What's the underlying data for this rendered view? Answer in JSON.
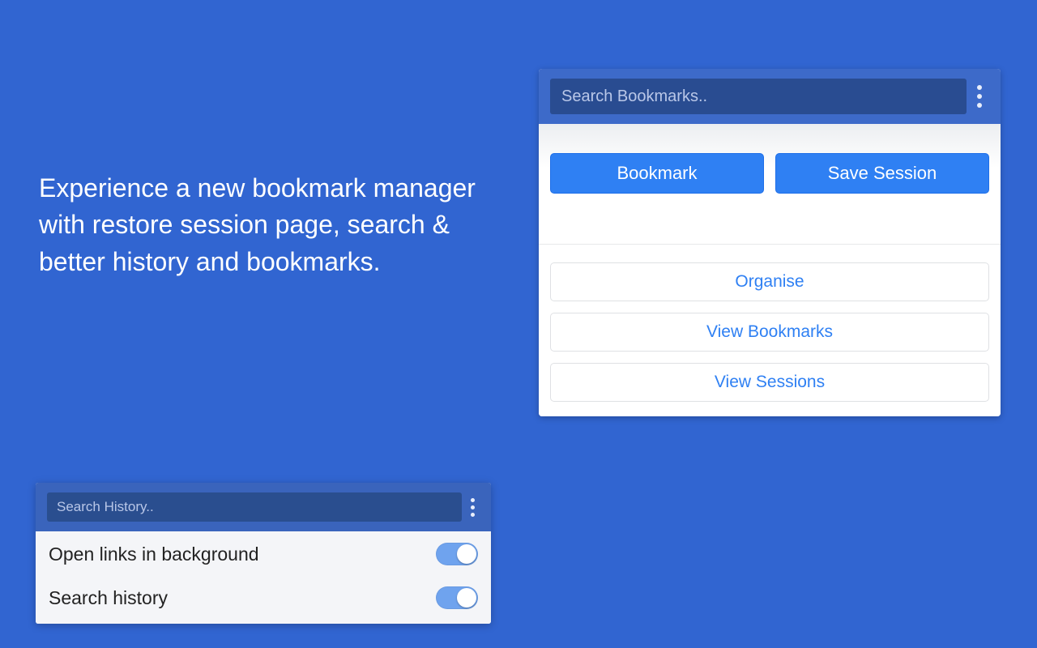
{
  "headline": "Experience a new bookmark manager with restore session page, search & better history and bookmarks.",
  "bookmark_panel": {
    "search_placeholder": "Search Bookmarks..",
    "primary_buttons": {
      "bookmark": "Bookmark",
      "save_session": "Save Session"
    },
    "outline_buttons": {
      "organise": "Organise",
      "view_bookmarks": "View Bookmarks",
      "view_sessions": "View Sessions"
    }
  },
  "history_panel": {
    "search_placeholder": "Search History..",
    "settings": [
      {
        "label": "Open links in background",
        "on": true
      },
      {
        "label": "Search history",
        "on": true
      }
    ]
  }
}
